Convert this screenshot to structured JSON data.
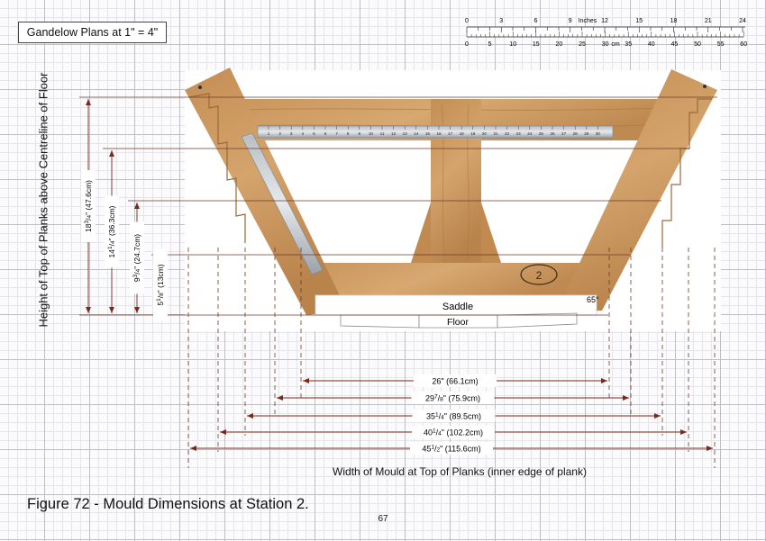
{
  "header": {
    "plan_label": "Gandelow Plans at 1\" = 4\""
  },
  "scale_bar": {
    "inches_label": "Inches",
    "cm_label": "cm",
    "inch_ticks": [
      "0",
      "3",
      "6",
      "9",
      "12",
      "15",
      "18",
      "21",
      "24"
    ],
    "cm_ticks": [
      "0",
      "5",
      "10",
      "15",
      "20",
      "25",
      "30",
      "35",
      "40",
      "45",
      "50",
      "55",
      "60"
    ]
  },
  "labels": {
    "saddle": "Saddle",
    "floor": "Floor",
    "angle": "65°",
    "y_axis": "Height of Top of Planks above Centreline of Floor",
    "x_axis": "Width of Mould at Top of Planks (inner edge of plank)"
  },
  "heights": [
    {
      "whole": "18",
      "frac": "3/4",
      "unit": "\" (47.6cm)"
    },
    {
      "whole": "14",
      "frac": "1/4",
      "unit": "\" (36.3cm)"
    },
    {
      "whole": "9",
      "frac": "3/4",
      "unit": "\" (24.7cm)"
    },
    {
      "whole": "5",
      "frac": "1/8",
      "unit": "\" (13cm)"
    }
  ],
  "widths": [
    {
      "whole": "26",
      "frac": "",
      "unit": "\" (66.1cm)"
    },
    {
      "whole": "29",
      "frac": "7/8",
      "unit": "\" (75.9cm)"
    },
    {
      "whole": "35",
      "frac": "1/4",
      "unit": "\" (89.5cm)"
    },
    {
      "whole": "40",
      "frac": "1/4",
      "unit": "\" (102.2cm)"
    },
    {
      "whole": "45",
      "frac": "1/2",
      "unit": "\" (115.6cm)"
    }
  ],
  "ruler_numbers": [
    "1",
    "2",
    "3",
    "4",
    "5",
    "6",
    "7",
    "8",
    "9",
    "10",
    "11",
    "12",
    "13",
    "14",
    "15",
    "16",
    "17",
    "18",
    "19",
    "20",
    "21",
    "22",
    "23",
    "24",
    "25",
    "26",
    "27",
    "28",
    "29",
    "30"
  ],
  "footer": {
    "caption": "Figure 72 - Mould Dimensions at Station 2.",
    "page_number": "67"
  }
}
